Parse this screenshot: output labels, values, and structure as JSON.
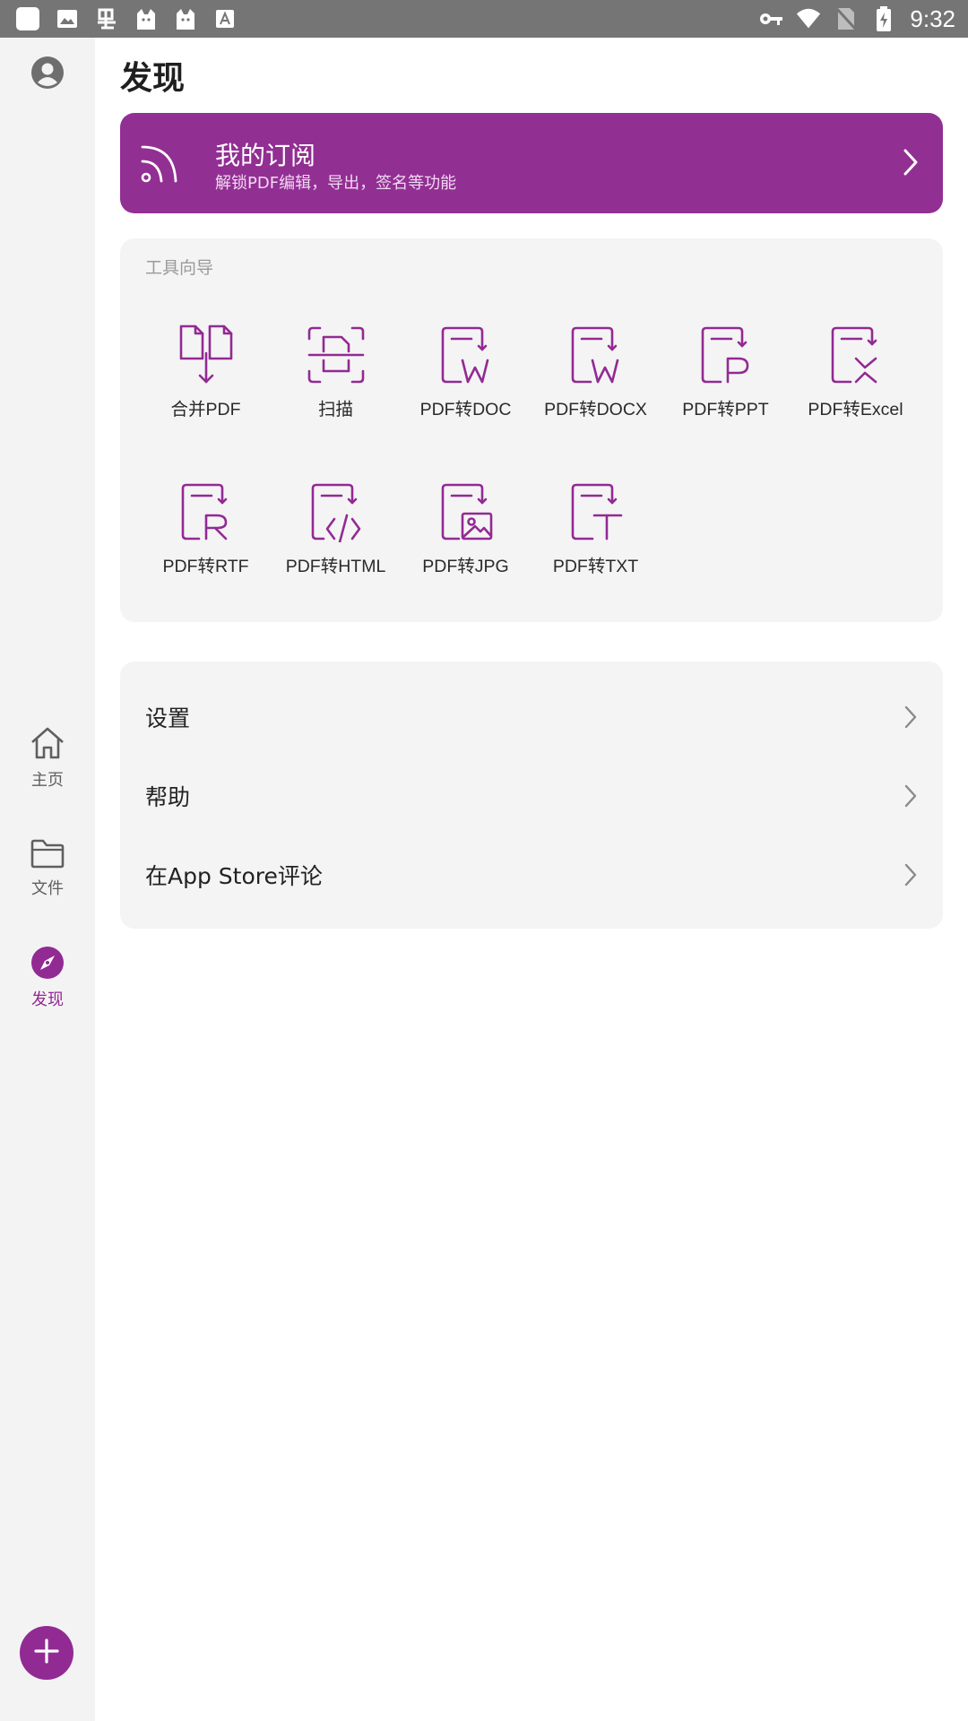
{
  "status_bar": {
    "time": "9:32",
    "left_icons": [
      "app-icon",
      "image-icon",
      "translate-icon",
      "cat-icon",
      "cat-icon",
      "font-icon"
    ],
    "right_icons": [
      "vpn-key-icon",
      "wifi-icon",
      "no-sim-icon",
      "battery-charging-icon"
    ]
  },
  "sidebar": {
    "items": [
      {
        "label": "主页",
        "icon": "home-icon"
      },
      {
        "label": "文件",
        "icon": "folder-icon"
      },
      {
        "label": "发现",
        "icon": "compass-icon",
        "active": true
      }
    ]
  },
  "page": {
    "title": "发现"
  },
  "subscription": {
    "title": "我的订阅",
    "description": "解锁PDF编辑，导出，签名等功能"
  },
  "tools": {
    "section_label": "工具向导",
    "items": [
      {
        "label": "合并PDF",
        "icon": "merge-pdf-icon"
      },
      {
        "label": "扫描",
        "icon": "scan-icon"
      },
      {
        "label": "PDF转DOC",
        "icon": "pdf-to-doc-icon"
      },
      {
        "label": "PDF转DOCX",
        "icon": "pdf-to-docx-icon"
      },
      {
        "label": "PDF转PPT",
        "icon": "pdf-to-ppt-icon"
      },
      {
        "label": "PDF转Excel",
        "icon": "pdf-to-excel-icon"
      },
      {
        "label": "PDF转RTF",
        "icon": "pdf-to-rtf-icon"
      },
      {
        "label": "PDF转HTML",
        "icon": "pdf-to-html-icon"
      },
      {
        "label": "PDF转JPG",
        "icon": "pdf-to-jpg-icon"
      },
      {
        "label": "PDF转TXT",
        "icon": "pdf-to-txt-icon"
      }
    ]
  },
  "menu": {
    "items": [
      {
        "label": "设置"
      },
      {
        "label": "帮助"
      },
      {
        "label": "在App Store评论"
      }
    ]
  },
  "colors": {
    "accent": "#922f93",
    "rail_bg": "#f3f3f3",
    "card_bg": "#f4f4f4",
    "status_bar": "#757575"
  }
}
